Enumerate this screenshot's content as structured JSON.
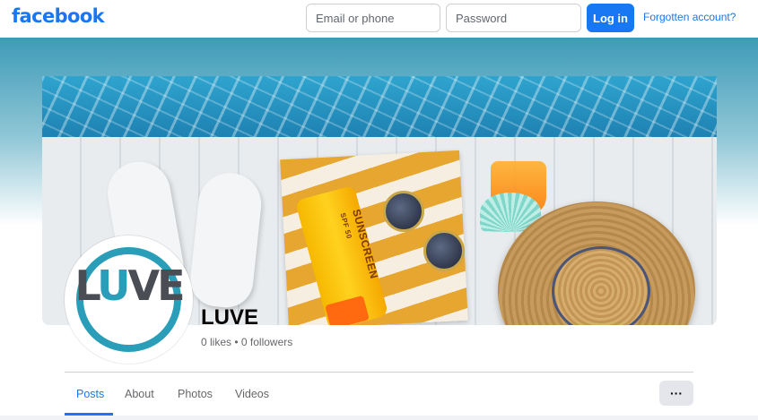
{
  "topbar": {
    "logo": "facebook",
    "email_placeholder": "Email or phone",
    "password_placeholder": "Password",
    "login_label": "Log in",
    "forgot_label": "Forgotten account?"
  },
  "cover": {
    "product_label": "SUNSCREEN",
    "product_spf": "SPF 50"
  },
  "profile": {
    "avatar_text_start": "L",
    "avatar_text_mid": "U",
    "avatar_text_end": "VE",
    "name": "LUVE",
    "stats": "0 likes • 0 followers"
  },
  "tabs": [
    {
      "label": "Posts",
      "active": true
    },
    {
      "label": "About",
      "active": false
    },
    {
      "label": "Photos",
      "active": false
    },
    {
      "label": "Videos",
      "active": false
    }
  ],
  "more_label": "···",
  "colors": {
    "brand": "#1877f2",
    "avatar_accent": "#2a9eb8"
  }
}
